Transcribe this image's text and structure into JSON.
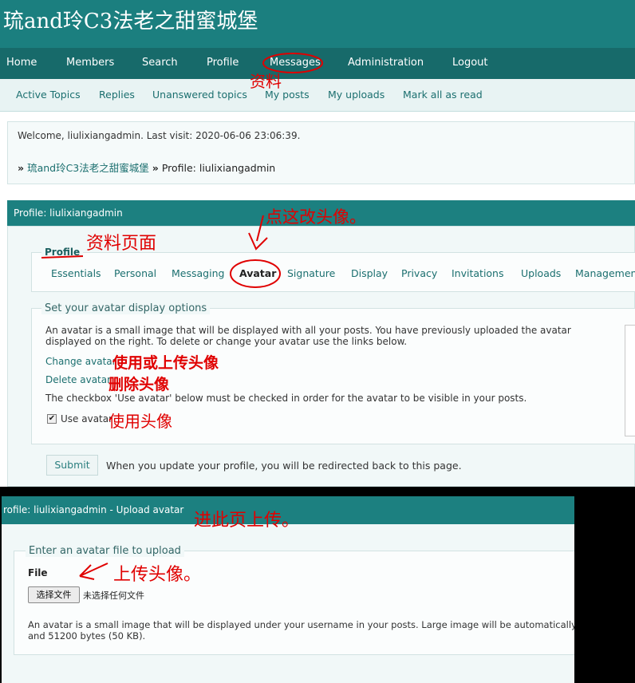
{
  "site": {
    "title": "琉and玲C3法老之甜蜜城堡"
  },
  "nav": [
    "Home",
    "Members",
    "Search",
    "Profile",
    "Messages",
    "Administration",
    "Logout"
  ],
  "subnav": [
    "Active Topics",
    "Replies",
    "Unanswered topics",
    "My posts",
    "My uploads",
    "Mark all as read"
  ],
  "welcome": {
    "prefix": "Welcome, ",
    "user": "liulixiangadmin",
    "last_visit_label": ".  Last visit: ",
    "last_visit": "2020-06-06 23:06:39",
    "suffix": "."
  },
  "breadcrumb": {
    "sep": "»",
    "home": "琉and玲C3法老之甜蜜城堡",
    "current": "Profile: liulixiangadmin"
  },
  "profile": {
    "heading": "Profile: liulixiangadmin",
    "legend": "Profile",
    "tabs": [
      "Essentials",
      "Personal",
      "Messaging",
      "Avatar",
      "Signature",
      "Display",
      "Privacy",
      "Invitations",
      "Uploads",
      "Managemen"
    ]
  },
  "avatar_options": {
    "legend": "Set your avatar display options",
    "description": "An avatar is a small image that will be displayed with all your posts. You have previously uploaded the avatar displayed on the right. To delete or change your avatar use the links below.",
    "change_link": "Change avatar",
    "delete_link": "Delete avatar",
    "note": "The checkbox 'Use avatar' below must be checked in order for the avatar to be visible in your posts.",
    "use_avatar_label": "Use avatar",
    "use_avatar_checked": true
  },
  "submit": {
    "label": "Submit",
    "note": "When you update your profile, you will be redirected back to this page."
  },
  "upload": {
    "heading": "rofile: liulixiangadmin - Upload avatar",
    "legend": "Enter an avatar file to upload",
    "file_label": "File",
    "choose_button": "选择文件",
    "no_file": "未选择任何文件",
    "desc_line1": "An avatar is a small image that will be displayed under your username in your posts. Large image will be automatically reduced",
    "desc_line2": "and 51200 bytes (50 KB)."
  },
  "annotations": {
    "messages": "资料",
    "profile_page": "资料页面",
    "click_avatar": "点这改头像。",
    "change_upload": "使用或上传头像",
    "delete": "删除头像",
    "use": "使用头像",
    "upload_page": "进此页上传。",
    "upload_avatar": "上传头像。"
  },
  "colors": {
    "header": "#1b7f7f",
    "nav": "#176a6a",
    "link": "#1b6f6f",
    "annotation": "#e00000"
  }
}
